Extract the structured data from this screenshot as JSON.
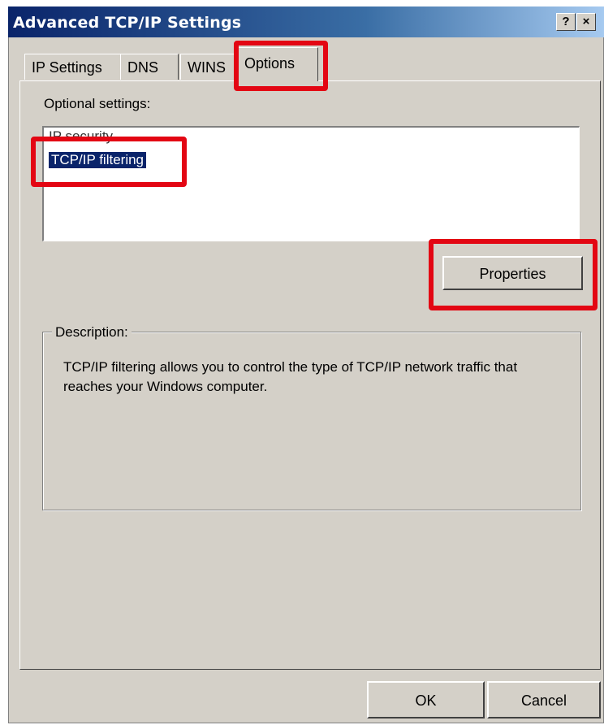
{
  "window": {
    "title": "Advanced TCP/IP Settings",
    "help_label": "?",
    "close_label": "×"
  },
  "tabs": [
    {
      "label": "IP Settings"
    },
    {
      "label": "DNS"
    },
    {
      "label": "WINS"
    },
    {
      "label": "Options",
      "selected": true
    }
  ],
  "options": {
    "label": "Optional settings:",
    "items": [
      {
        "label": "IP security"
      },
      {
        "label": "TCP/IP filtering",
        "selected": true
      }
    ],
    "properties_label": "Properties"
  },
  "description": {
    "legend": "Description:",
    "text": "TCP/IP filtering allows you to control the type of TCP/IP network traffic that reaches your Windows computer."
  },
  "footer": {
    "ok_label": "OK",
    "cancel_label": "Cancel"
  },
  "colors": {
    "title_bar": "#0a246a",
    "dialog_face": "#d4d0c8",
    "selection": "#0a246a",
    "highlight_annotation": "#e30613"
  }
}
